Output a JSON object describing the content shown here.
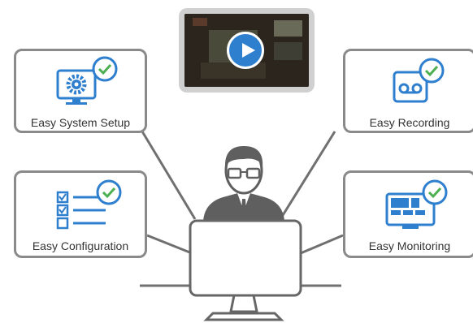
{
  "cards": {
    "system_setup": "Easy System Setup",
    "recording": "Easy Recording",
    "configuration": "Easy Configuration",
    "monitoring": "Easy Monitoring"
  },
  "colors": {
    "accent_blue": "#2f7fcf",
    "check_green": "#4caf50",
    "border_gray": "#8a8a8a",
    "figure_gray": "#666666"
  },
  "icons": [
    "gear-monitor-icon",
    "tape-recorder-icon",
    "checklist-icon",
    "monitor-grid-icon",
    "checkmark-icon",
    "play-icon",
    "user-at-computer-icon"
  ]
}
